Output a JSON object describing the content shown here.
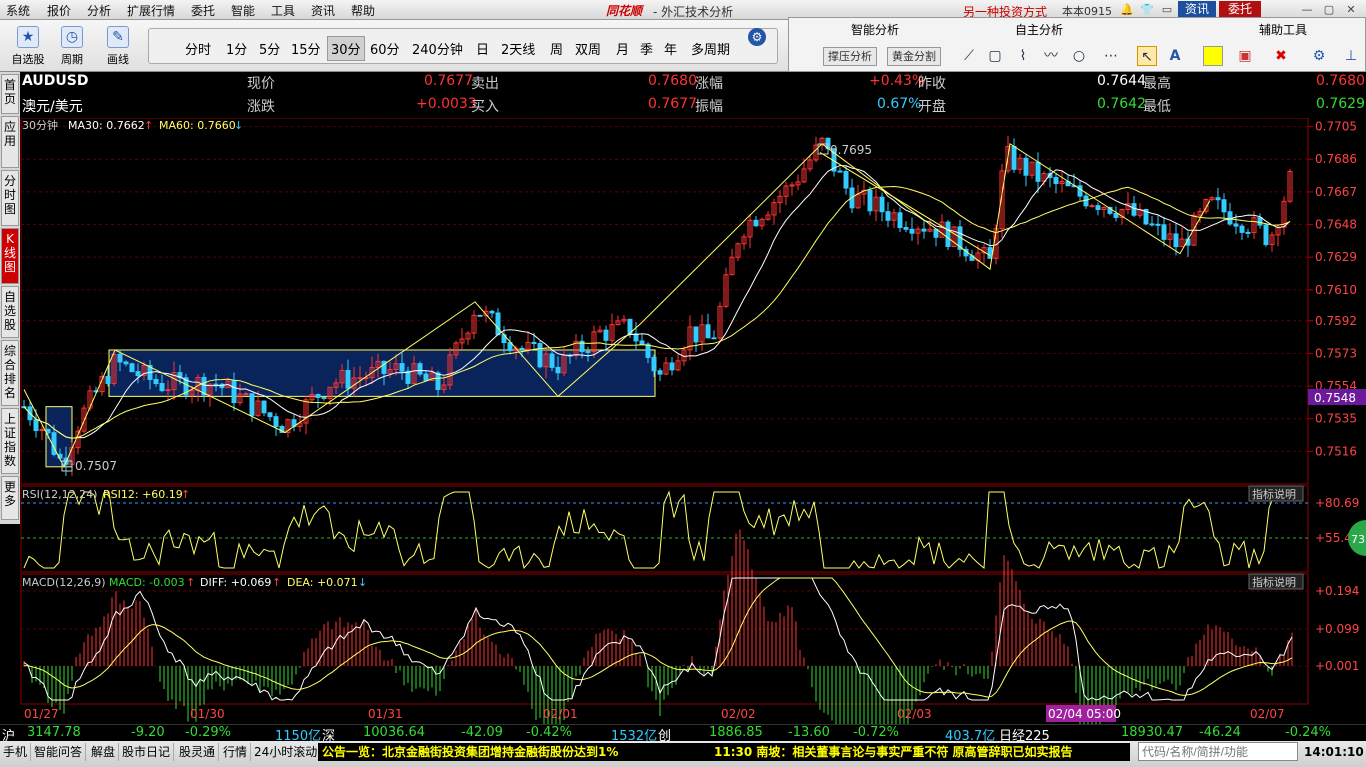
{
  "menu": {
    "items": [
      "系统",
      "报价",
      "分析",
      "扩展行情",
      "委托",
      "智能",
      "工具",
      "资讯",
      "帮助"
    ],
    "brand": "同花顺",
    "title": "- 外汇技术分析",
    "promo": "另一种投资方式",
    "user": "本本0915",
    "news_btn": "资讯",
    "trade_btn": "委托"
  },
  "toolbar": {
    "tools": [
      {
        "label": "自选股",
        "icon": "star-icon"
      },
      {
        "label": "周期",
        "icon": "clock-icon"
      },
      {
        "label": "画线",
        "icon": "pencil-icon"
      }
    ],
    "periods": [
      "分时",
      "1分",
      "5分",
      "15分",
      "30分",
      "60分",
      "240分钟",
      "日",
      "2天线",
      "周",
      "双周",
      "月",
      "季",
      "年",
      "多周期"
    ],
    "active_period": "30分"
  },
  "analysis_panel": {
    "headers": [
      "智能分析",
      "自主分析",
      "辅助工具"
    ],
    "buttons": [
      "撑压分析",
      "黄金分割"
    ]
  },
  "sidebar": {
    "tabs": [
      "首页",
      "应用",
      "分时图",
      "K线图",
      "自选股",
      "综合排名",
      "上证指数",
      "更多"
    ],
    "active": "K线图"
  },
  "quote": {
    "symbol": "AUDUSD",
    "name": "澳元/美元",
    "now_label": "现价",
    "now": "0.7677",
    "chg_label": "涨跌",
    "chg": "+0.0033",
    "sell_label": "卖出",
    "sell": "0.7680",
    "buy_label": "买入",
    "buy": "0.7677",
    "pct_label": "涨幅",
    "pct": "+0.43%",
    "amp_label": "振幅",
    "amp": "0.67%",
    "prev_label": "昨收",
    "prev": "0.7644",
    "open_label": "开盘",
    "open": "0.7642",
    "high_label": "最高",
    "high": "0.7680",
    "low_label": "最低",
    "low": "0.7629"
  },
  "chart_data": {
    "type": "candlestick",
    "period": "30分钟",
    "ma30_label": "MA30: 0.7662",
    "ma60_label": "MA60: 0.7660",
    "y_ticks": [
      "0.7705",
      "0.7686",
      "0.7667",
      "0.7648",
      "0.7629",
      "0.7610",
      "0.7592",
      "0.7573",
      "0.7554",
      "0.7535",
      "0.7516"
    ],
    "y_range": [
      0.7497,
      0.771
    ],
    "current_price_tag": "0.7548",
    "high_marker": "0.7695",
    "low_marker": "0.7507",
    "x_labels": [
      "01/27",
      "01/30",
      "01/31",
      "02/01",
      "02/02",
      "02/03",
      "02/04 05:00",
      "02/07"
    ],
    "highlight_x_label": "02/04 05:00",
    "rsi": {
      "label": "RSI(12,12,24)",
      "value_label": "RSI12: +60.19",
      "ticks": [
        "+80.69",
        "+55.46"
      ],
      "bubble": "73",
      "help": "指标说明"
    },
    "macd": {
      "label": "MACD(12,26,9)",
      "macd_label": "MACD: -0.003",
      "diff_label": "DIFF: +0.069",
      "dea_label": "DEA: +0.071",
      "ticks": [
        "+0.194",
        "+0.099",
        "+0.001"
      ],
      "help": "指标说明"
    },
    "colors": {
      "up": "#ff3333",
      "down": "#33ccff",
      "ma_white": "#ffffff",
      "ma_yellow": "#ffff66",
      "box": "#0a2a6a"
    }
  },
  "status": {
    "sh_label": "沪",
    "sh": "3147.78",
    "sh_chg": "-9.20",
    "sh_pct": "-0.29%",
    "sh_vol": "1150亿",
    "sz_label": "深",
    "sz": "10036.64",
    "sz_chg": "-42.09",
    "sz_pct": "-0.42%",
    "sz_vol": "1532亿",
    "cy_label": "创",
    "cy": "1886.85",
    "cy_chg": "-13.60",
    "cy_pct": "-0.72%",
    "cy_vol": "403.7亿",
    "nk_label": "日经225",
    "nk": "18930.47",
    "nk_chg": "-46.24",
    "nk_pct": "-0.24%"
  },
  "ticker": {
    "items": [
      "手机",
      "智能问答",
      "解盘",
      "股市日记",
      "股灵通",
      "行情",
      "24小时滚动"
    ],
    "news1": "公告一览：北京金融街投资集团增持金融街股份达到1%",
    "news2": "11:30 南坡：相关董事言论与事实严重不符 原高管辞职已如实报告",
    "code_placeholder": "代码/名称/简拼/功能",
    "clock": "14:01:10"
  }
}
